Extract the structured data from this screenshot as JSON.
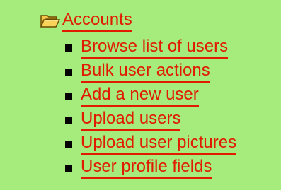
{
  "category": {
    "title": "Accounts",
    "icon": "folder-open-icon"
  },
  "items": [
    {
      "label": "Browse list of users"
    },
    {
      "label": "Bulk user actions"
    },
    {
      "label": "Add a new user"
    },
    {
      "label": "Upload users"
    },
    {
      "label": "Upload user pictures"
    },
    {
      "label": "User profile fields"
    }
  ],
  "colors": {
    "background": "#a6ec7d",
    "link": "#e11b00",
    "bullet": "#000000"
  }
}
